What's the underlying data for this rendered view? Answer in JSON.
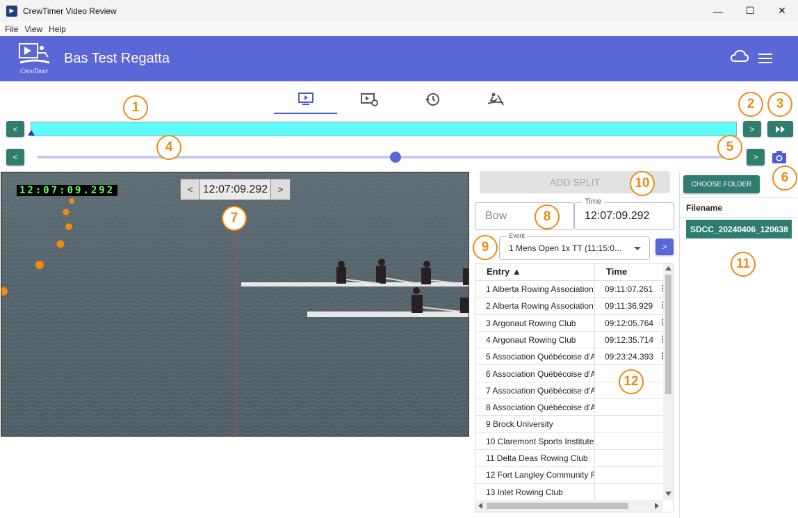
{
  "window": {
    "title": "CrewTimer Video Review",
    "minimize": "—",
    "maximize": "☐",
    "close": "✕"
  },
  "menu": [
    "File",
    "View",
    "Help"
  ],
  "header": {
    "regatta_name": "Bas Test Regatta",
    "logo_text": "CrewTimer"
  },
  "nav": {
    "prev_clip": "<",
    "next_clip": ">",
    "fast_forward": "▸▸",
    "prev_frame": "<",
    "next_frame": ">"
  },
  "slider": {
    "position_fraction": 0.51
  },
  "video": {
    "overlay_time": "12:07:09.292"
  },
  "time_stepper": {
    "prev": "<",
    "value": "12:07:09.292",
    "next": ">"
  },
  "split": {
    "add_split_label": "ADD SPLIT",
    "bow_placeholder": "Bow",
    "time_legend": "Time",
    "time_value": "12:07:09.292",
    "event_legend": "Event",
    "event_value": "1 Mens Open 1x TT (11:15:0...",
    "event_next": ">"
  },
  "table": {
    "columns": [
      "Entry ▲",
      "Time"
    ],
    "rows": [
      {
        "entry": "1 Alberta Rowing Association",
        "time": "09:11:07.261"
      },
      {
        "entry": "2 Alberta Rowing Association",
        "time": "09:11:36.929"
      },
      {
        "entry": "3 Argonaut Rowing Club",
        "time": "09:12:05.764"
      },
      {
        "entry": "4 Argonaut Rowing Club",
        "time": "09:12:35.714"
      },
      {
        "entry": "5 Association Québécoise d'A",
        "time": "09:23:24.393"
      },
      {
        "entry": "6 Association Québécoise d'A",
        "time": ""
      },
      {
        "entry": "7 Association Québécoise d'A",
        "time": ""
      },
      {
        "entry": "8 Association Québécoise d'A",
        "time": ""
      },
      {
        "entry": "9 Brock University",
        "time": ""
      },
      {
        "entry": "10 Claremont Sports Institute",
        "time": ""
      },
      {
        "entry": "11 Delta Deas Rowing Club",
        "time": ""
      },
      {
        "entry": "12 Fort Langley Community R",
        "time": ""
      },
      {
        "entry": "13 Inlet Rowing Club",
        "time": ""
      }
    ]
  },
  "files": {
    "choose_label": "CHOOSE FOLDER",
    "column": "Filename",
    "selected": "SDCC_20240406_120638"
  },
  "callouts": [
    "1",
    "2",
    "3",
    "4",
    "5",
    "6",
    "7",
    "8",
    "9",
    "10",
    "11",
    "12"
  ],
  "colors": {
    "accent": "#5b67d6",
    "button_green": "#2e7d6f",
    "callout": "#f08a10",
    "timeline": "#5ffcfa"
  }
}
